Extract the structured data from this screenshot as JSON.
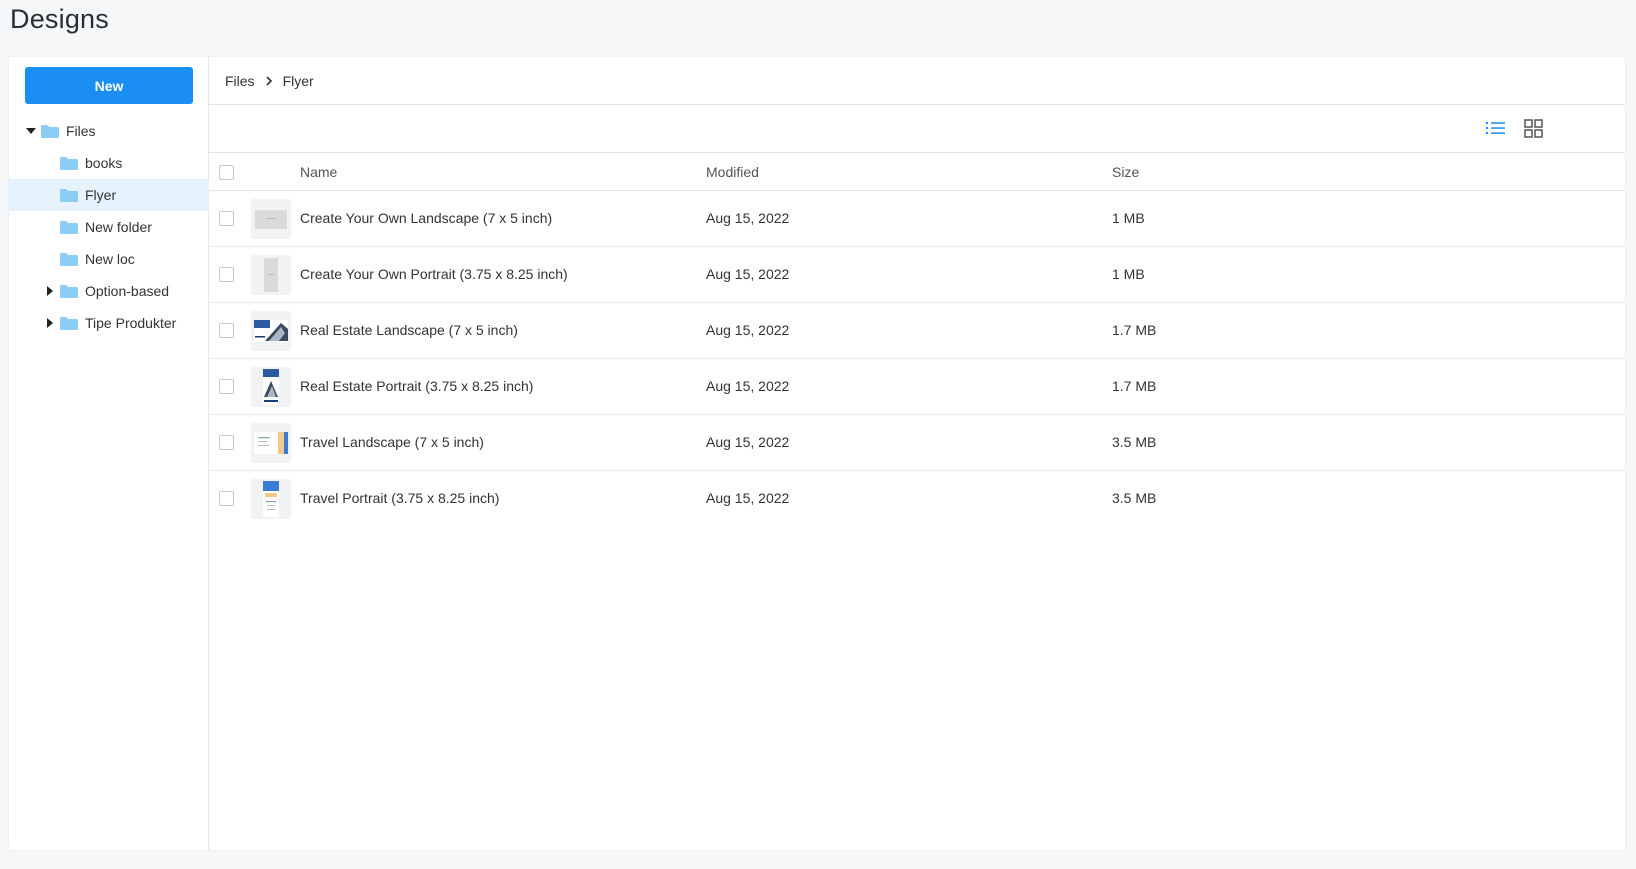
{
  "page": {
    "title": "Designs"
  },
  "sidebar": {
    "new_label": "New",
    "tree": [
      {
        "label": "Files",
        "caret": "down",
        "level": 0,
        "selected": false
      },
      {
        "label": "books",
        "caret": "none",
        "level": 1,
        "selected": false
      },
      {
        "label": "Flyer",
        "caret": "none",
        "level": 1,
        "selected": true
      },
      {
        "label": "New folder",
        "caret": "none",
        "level": 1,
        "selected": false
      },
      {
        "label": "New loc",
        "caret": "none",
        "level": 1,
        "selected": false
      },
      {
        "label": "Option-based",
        "caret": "right",
        "level": 1,
        "selected": false
      },
      {
        "label": "Tipe Produkter",
        "caret": "right",
        "level": 1,
        "selected": false
      }
    ]
  },
  "breadcrumb": {
    "root": "Files",
    "current": "Flyer"
  },
  "toolbar": {
    "list_view_icon": "list-view-icon",
    "grid_view_icon": "grid-view-icon",
    "active": "list"
  },
  "table": {
    "headers": {
      "name": "Name",
      "modified": "Modified",
      "size": "Size"
    },
    "rows": [
      {
        "name": "Create Your Own Landscape (7 x 5 inch)",
        "modified": "Aug 15, 2022",
        "size": "1 MB",
        "thumb": "blank-landscape"
      },
      {
        "name": "Create Your Own Portrait (3.75 x 8.25 inch)",
        "modified": "Aug 15, 2022",
        "size": "1 MB",
        "thumb": "blank-portrait"
      },
      {
        "name": "Real Estate Landscape (7 x 5 inch)",
        "modified": "Aug 15, 2022",
        "size": "1.7 MB",
        "thumb": "realestate-landscape"
      },
      {
        "name": "Real Estate Portrait (3.75 x 8.25 inch)",
        "modified": "Aug 15, 2022",
        "size": "1.7 MB",
        "thumb": "realestate-portrait"
      },
      {
        "name": "Travel Landscape (7 x 5 inch)",
        "modified": "Aug 15, 2022",
        "size": "3.5 MB",
        "thumb": "travel-landscape"
      },
      {
        "name": "Travel Portrait (3.75 x 8.25 inch)",
        "modified": "Aug 15, 2022",
        "size": "3.5 MB",
        "thumb": "travel-portrait"
      }
    ]
  },
  "colors": {
    "accent": "#1a8ef2",
    "folder": "#8ccdf5",
    "selected_bg": "#e6f3fd"
  }
}
